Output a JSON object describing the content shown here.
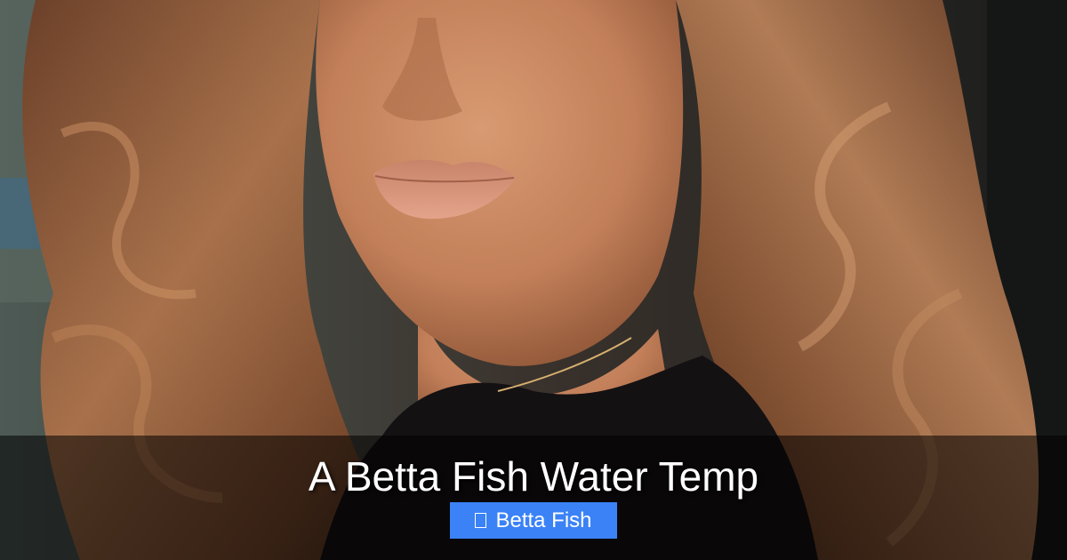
{
  "title": "A Betta Fish Water Temp",
  "category": {
    "label": "Betta Fish",
    "icon": "folder-icon",
    "color": "#3b82f6"
  },
  "overlay_color": "#000000"
}
